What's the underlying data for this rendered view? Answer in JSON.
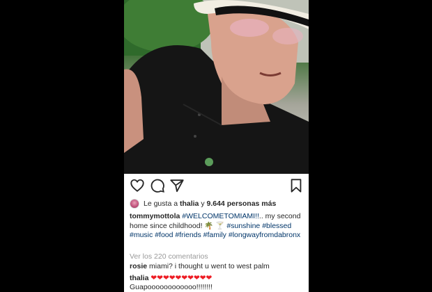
{
  "actions": {
    "like_icon": "heart-outline-icon",
    "comment_icon": "comment-icon",
    "share_icon": "paper-plane-icon",
    "save_icon": "bookmark-icon"
  },
  "likes": {
    "prefix": "Le gusta a",
    "user": "thalia",
    "middle": "y",
    "count": "9.644 personas más"
  },
  "caption": {
    "username": "tommymottola",
    "tag1": "#WELCOMETOMIAMI!!",
    "text1": ".. my second home since childhood! 🌴 🍸 ",
    "tags": [
      "#sunshine",
      "#blessed",
      "#music",
      "#food",
      "#friends",
      "#family",
      "#longwayfromdabronx"
    ]
  },
  "view_comments": "Ver los 220 comentarios",
  "comments": [
    {
      "username": "rosie",
      "text": "miami? i thought u went to west palm"
    },
    {
      "username": "thalia",
      "text": "❤❤❤❤❤❤❤❤❤❤",
      "text2": "Guapoooooooooooo!!!!!!!!"
    }
  ],
  "colors": {
    "hashtag": "#003569",
    "muted": "#999999",
    "text": "#262626",
    "heart": "#ed1c24"
  }
}
